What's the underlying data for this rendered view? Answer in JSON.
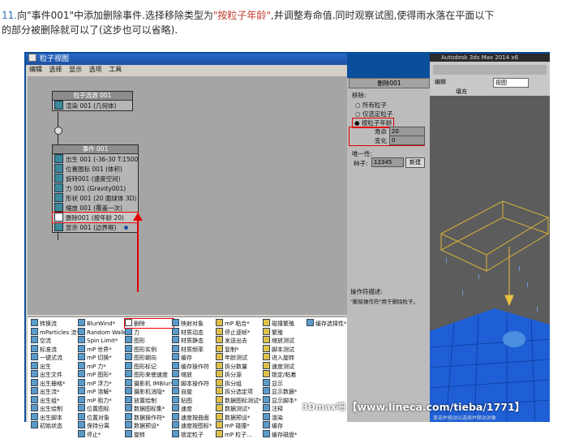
{
  "caption": {
    "line1_num": "11.",
    "line1_a": "向\"事件001\"中添加删除事件.选择移除类型为",
    "line1_hl": "\"按粒子年龄\"",
    "line1_b": ",并调整寿命值.同时观察试图,使得雨水落在平面以下",
    "line2": "的部分被删除就可以了(这步也可以省略)."
  },
  "window": {
    "title": "粒子视图",
    "menu": [
      "编辑",
      "选择",
      "显示",
      "选项",
      "工具"
    ]
  },
  "source_node": {
    "header": "粒子流源 001",
    "rows": [
      "渲染 001 (几何体)"
    ]
  },
  "event_node": {
    "header": "事件 001",
    "rows": [
      "出生 001 (-36-30 T:1500)",
      "位置图标 001 (体积)",
      "旋转001 (速度空间)",
      "力 001 (Gravity001)",
      "形状 001 (20 面球体 3D)",
      "缩放 001 (覆盖一次)",
      "删除001 (按年龄 20)",
      "显示 001 (边界框)"
    ],
    "selected_index": 6
  },
  "properties": {
    "header": "删除001",
    "group": "移除:",
    "options": [
      "所有粒子",
      "仅选定粒子",
      "按粒子年龄"
    ],
    "selected_option": 2,
    "life_label": "寿命",
    "life_value": "20",
    "variation_label": "变化",
    "variation_value": "0",
    "unique_label": "唯一性:",
    "seed_label": "种子:",
    "seed_value": "12345",
    "new_button": "新建",
    "desc_label": "操作符描述:",
    "desc_text": "\"删除操作符\"用于删除粒子。"
  },
  "operators": [
    [
      "转换流",
      "mParticles 流*",
      "空流",
      "标准流",
      "一键式流",
      "出生",
      "出生文件",
      "出生栅格*",
      "出生流*",
      "出生组*",
      "出生绘制",
      "出生脚本",
      "初始状态"
    ],
    [
      "BlurWind*",
      "Random Walk*",
      "Spin Limit*",
      "mP 世界*",
      "mP 切换*",
      "mP 力*",
      "mP 图形*",
      "mP 浮力*",
      "mP 溶解*",
      "mP 阻力*",
      "位置图标",
      "位置对象",
      "保持分离",
      "停止*"
    ],
    [
      "删除",
      "力",
      "图形",
      "图形实例",
      "图形朝向",
      "图形标记",
      "图形来使速度",
      "摄影机 IMBlur*",
      "摄影机消隐*",
      "放置绘制",
      "数据图标集*",
      "数据操作符*",
      "数据预设*",
      "旋转"
    ],
    [
      "映射对象",
      "材质动态",
      "材质静态",
      "材质频率",
      "缓存",
      "缓存操作符",
      "缩放",
      "脚本操作符",
      "自旋",
      "贴图",
      "速度",
      "速度按曲面",
      "速度按图标*",
      "锁定粒子"
    ],
    [
      "mP 粘合*",
      "停止逐帧*",
      "发送出去",
      "复制*",
      "年龄测试",
      "拆分数量",
      "拆分源",
      "拆分组",
      "拆分选定项",
      "数据图标测试*",
      "数据测试*",
      "数据预设*",
      "mP 碰撞*",
      "mP 粒子..."
    ],
    [
      "碰撞繁殖",
      "繁殖",
      "缩放测试",
      "脚本测试",
      "进入旋转",
      "速度测试",
      "锁定/粘着",
      "显示",
      "显示数据*",
      "显示脚本*",
      "注释",
      "渲染",
      "缓存",
      "缓存磁盘*"
    ],
    [
      "缓存选择性*"
    ]
  ],
  "viewport": {
    "title": "Autodesk 3ds Max 2014 x6",
    "view_label": "视图",
    "edit_label": "编辑",
    "fill_label": "填充",
    "status": "单击并拖动以选择并移动对象"
  },
  "watermark": {
    "left": "3Dmax吧",
    "url": "【www.lineca.com/tieba/1771】"
  },
  "colors": {
    "titlebar": "#1d4fa3",
    "selection": "#e00000",
    "viewport_mesh": "#1e5fd6"
  }
}
